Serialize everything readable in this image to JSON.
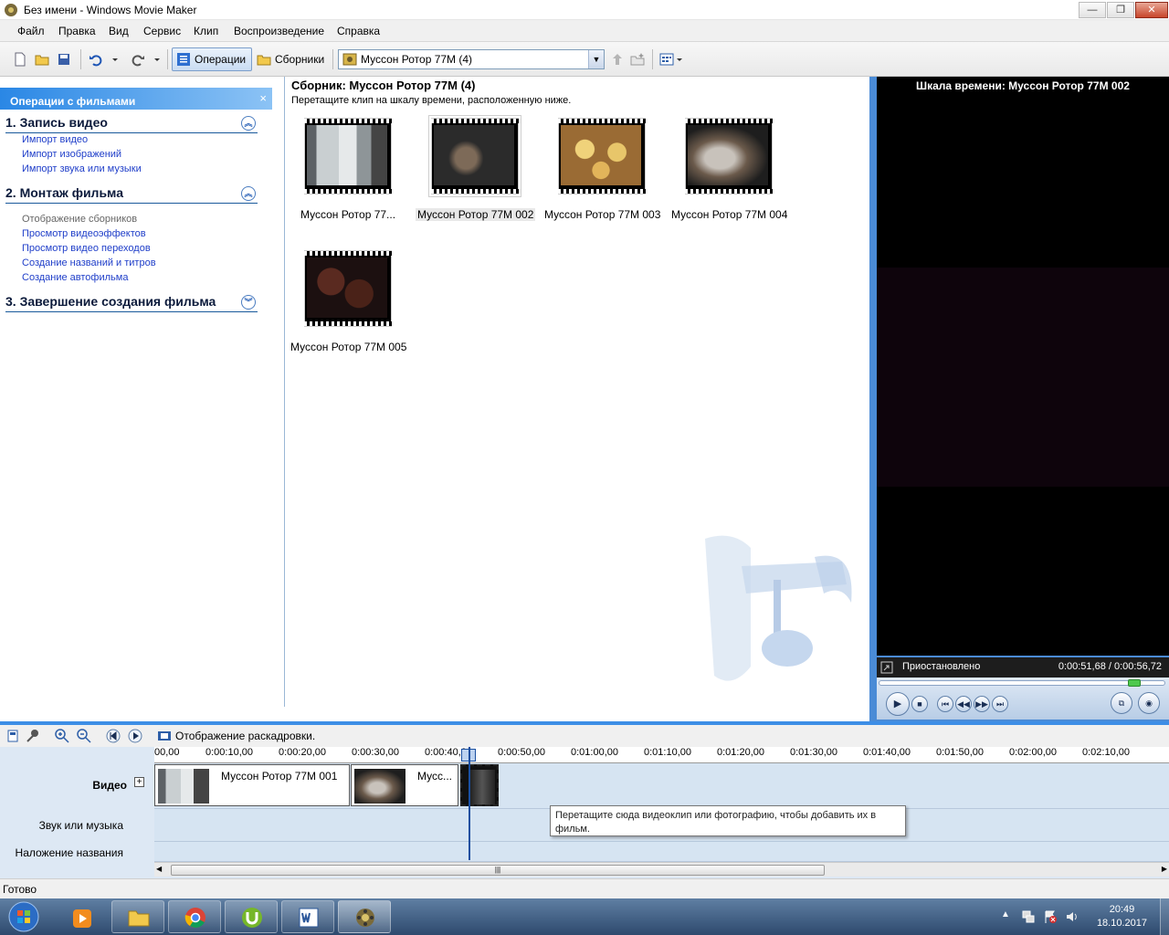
{
  "window": {
    "title": "Без имени - Windows Movie Maker",
    "min_glyph": "—",
    "max_glyph": "❐",
    "close_glyph": "✕"
  },
  "menu": [
    "Файл",
    "Правка",
    "Вид",
    "Сервис",
    "Клип",
    "Воспроизведение",
    "Справка"
  ],
  "toolbar": {
    "operations_label": "Операции",
    "collections_label": "Сборники",
    "collection_select": "Муссон Ротор 77М (4)"
  },
  "taskpane": {
    "header": "Операции с фильмами",
    "close_glyph": "×",
    "sections": [
      {
        "title": "1. Запись видео",
        "toggle": "︽",
        "links": [
          "Импорт видео",
          "Импорт изображений",
          "Импорт звука или музыки"
        ]
      },
      {
        "title": "2. Монтаж фильма",
        "toggle": "︽",
        "links": [
          "Отображение сборников",
          "Просмотр видеоэффектов",
          "Просмотр видео переходов",
          "Создание названий и титров",
          "Создание автофильма"
        ]
      },
      {
        "title": "3. Завершение создания фильма",
        "toggle": "︾",
        "links": []
      }
    ]
  },
  "collection": {
    "title": "Сборник: Муссон Ротор 77М (4)",
    "hint": "Перетащите клип на шкалу времени, расположенную ниже.",
    "clips": [
      {
        "name": "Муссон Ротор 77..."
      },
      {
        "name": "Муссон Ротор 77М 002"
      },
      {
        "name": "Муссон Ротор 77М 003"
      },
      {
        "name": "Муссон Ротор 77М 004"
      },
      {
        "name": "Муссон Ротор 77М 005"
      }
    ]
  },
  "preview": {
    "title": "Шкала времени: Муссон Ротор 77М 002",
    "status": "Приостановлено",
    "time": "0:00:51,68 / 0:00:56,72"
  },
  "timeline": {
    "view_label": "Отображение раскадровки.",
    "ruler_ticks": [
      "00,00",
      "0:00:10,00",
      "0:00:20,00",
      "0:00:30,00",
      "0:00:40,00",
      "0:00:50,00",
      "0:01:00,00",
      "0:01:10,00",
      "0:01:20,00",
      "0:01:30,00",
      "0:01:40,00",
      "0:01:50,00",
      "0:02:00,00",
      "0:02:10,00"
    ],
    "tracks": {
      "video": "Видео",
      "video_expand": "+",
      "audio": "Звук или музыка",
      "title_overlay": "Наложение названия"
    },
    "clips": [
      {
        "name": "Муссон Ротор 77М 001"
      },
      {
        "name": "Мусс..."
      }
    ],
    "tooltip": "Перетащите сюда видеоклип или фотографию, чтобы добавить их в фильм.",
    "scroll_grip": "|||"
  },
  "status": "Готово",
  "taskbar": {
    "time": "20:49",
    "date": "18.10.2017"
  },
  "colors": {
    "taskpane_header": "#2a87e5",
    "link": "#1f3ec9",
    "accent": "#3d8ee6"
  }
}
